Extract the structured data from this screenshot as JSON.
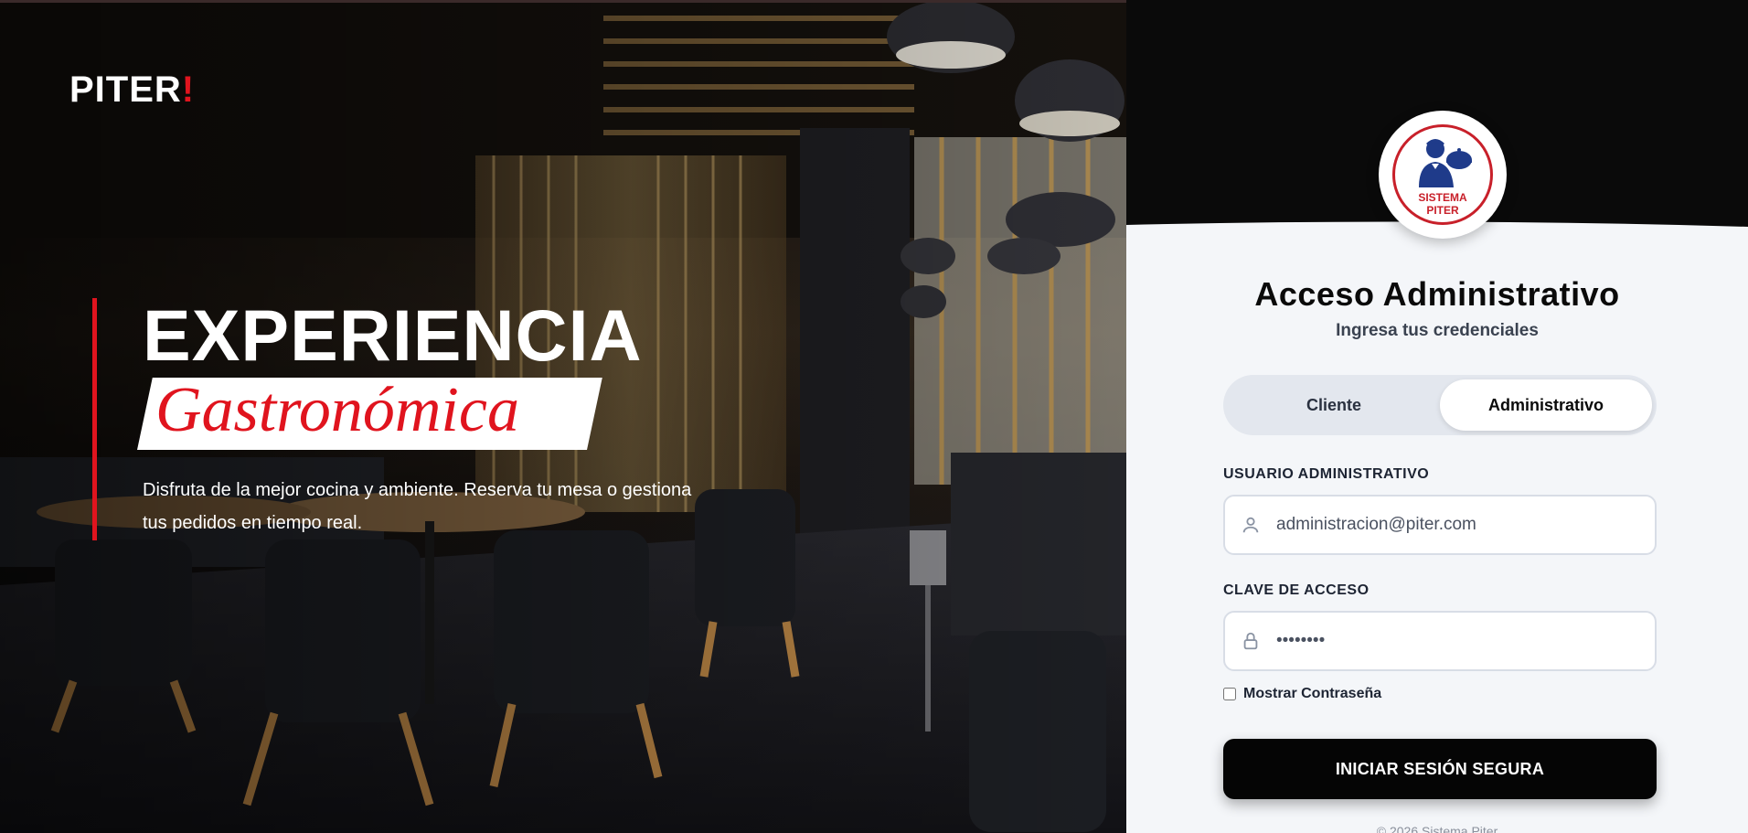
{
  "brand": {
    "name": "PITER",
    "mark": "!"
  },
  "hero": {
    "title": "EXPERIENCIA",
    "subtitle": "Gastronómica",
    "description": "Disfruta de la mejor cocina y ambiente. Reserva tu mesa o gestiona tus pedidos en tiempo real."
  },
  "logo": {
    "line1": "SISTEMA",
    "line2": "PITER"
  },
  "panel": {
    "title": "Acceso Administrativo",
    "subtitle": "Ingresa tus credenciales"
  },
  "toggle": {
    "options": [
      "Cliente",
      "Administrativo"
    ],
    "active": "Administrativo"
  },
  "form": {
    "user_label": "USUARIO ADMINISTRATIVO",
    "user_value": "administracion@piter.com",
    "user_icon": "user-icon",
    "pass_label": "CLAVE DE ACCESO",
    "pass_value": "••••••••",
    "pass_icon": "lock-icon",
    "show_password_label": "Mostrar Contraseña",
    "submit_label": "INICIAR SESIÓN SEGURA"
  },
  "footer": {
    "text": "© 2026 Sistema Piter"
  },
  "colors": {
    "accent": "#e0141e",
    "dark": "#050505",
    "panel_bg": "#f4f6f9"
  }
}
